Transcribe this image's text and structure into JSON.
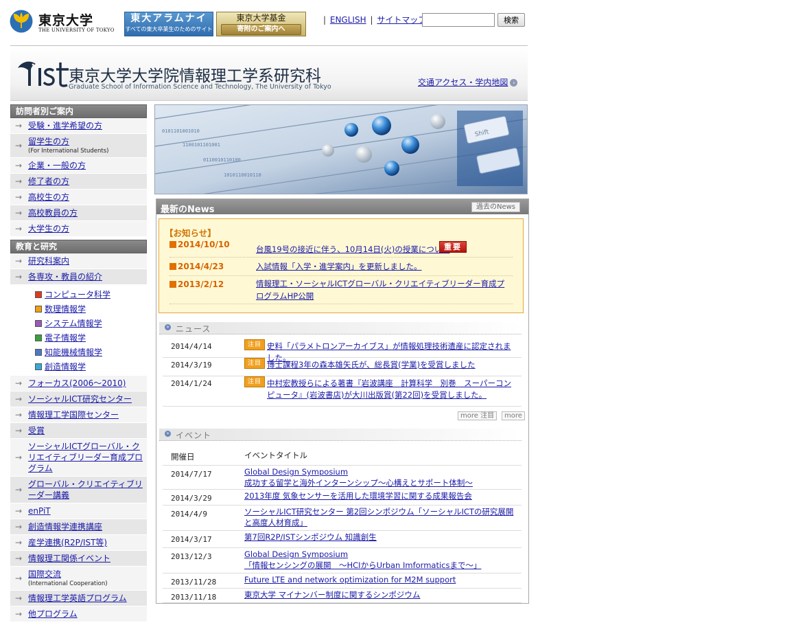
{
  "top": {
    "logo_jp": "東京大学",
    "logo_en": "THE UNIVERSITY OF TOKYO",
    "alumni_title": "東大アラムナイ",
    "alumni_sub": "すべての東大卒業生のためのサイト",
    "fund_title": "東京大学基金",
    "fund_sub": "寄附のご案内へ",
    "link_english": "ENGLISH",
    "link_sitemap": "サイトマップ",
    "search_value": "",
    "search_button": "検索"
  },
  "header": {
    "title": "東京大学大学院情報理工学系研究科",
    "subtitle": "Graduate School of Information Science and Technology, The University of Tokyo",
    "access_link": "交通アクセス・学内地図"
  },
  "sidebar": {
    "visitors_title": "訪問者別ご案内",
    "visitors": [
      {
        "label": "受験・進学希望の方",
        "sub": ""
      },
      {
        "label": "留学生の方",
        "sub": "(For International Students)"
      },
      {
        "label": "企業・一般の方",
        "sub": ""
      },
      {
        "label": "修了者の方",
        "sub": ""
      },
      {
        "label": "高校生の方",
        "sub": ""
      },
      {
        "label": "高校教員の方",
        "sub": ""
      },
      {
        "label": "大学生の方",
        "sub": ""
      }
    ],
    "edu_title": "教育と研究",
    "edu_top": [
      "研究科案内",
      "各専攻・教員の紹介"
    ],
    "departments": [
      {
        "label": "コンピュータ科学",
        "color": "#e03a1e"
      },
      {
        "label": "数理情報学",
        "color": "#f0a010"
      },
      {
        "label": "システム情報学",
        "color": "#9a58b8"
      },
      {
        "label": "電子情報学",
        "color": "#3aa03a"
      },
      {
        "label": "知能機械情報学",
        "color": "#4a78c8"
      },
      {
        "label": "創造情報学",
        "color": "#38a8d8"
      }
    ],
    "edu_rest": [
      {
        "label": "フォーカス(2006〜2010)",
        "sub": ""
      },
      {
        "label": "ソーシャルICT研究センター",
        "sub": ""
      },
      {
        "label": "情報理工学国際センター",
        "sub": ""
      },
      {
        "label": "受賞",
        "sub": ""
      },
      {
        "label": "ソーシャルICTグローバル・クリエイティブリーダー育成プログラム",
        "sub": ""
      },
      {
        "label": "グローバル・クリエイティブリーダー講義",
        "sub": ""
      },
      {
        "label": "enPiT",
        "sub": ""
      },
      {
        "label": "創造情報学連携講座",
        "sub": ""
      },
      {
        "label": "産学連携(R2P/IST等)",
        "sub": ""
      },
      {
        "label": "情報理工関係イベント",
        "sub": ""
      },
      {
        "label": "国際交流",
        "sub": "(International Cooperation)"
      },
      {
        "label": "情報理工学英語プログラム",
        "sub": ""
      },
      {
        "label": "他プログラム",
        "sub": ""
      }
    ]
  },
  "hero": {
    "key_label": "Shift"
  },
  "news": {
    "title": "最新のNews",
    "past_button": "過去のNews",
    "notice_title": "【お知らせ】",
    "important_badge": "重要",
    "notices": [
      {
        "date": "2014/10/10",
        "text": "台風19号の接近に伴う、10月14日(火)の授業について"
      },
      {
        "date": "2014/4/23",
        "text": "入試情報「入学・進学案内」を更新しました。"
      },
      {
        "date": "2013/2/12",
        "text": "情報理工・ソーシャルICTグローバル・クリエイティブリーダー育成プログラムHP公開"
      }
    ],
    "news_section": "ニュース",
    "items": [
      {
        "date": "2014/4/14",
        "tag": "注目",
        "text": "史料「パラメトロンアーカイブス」が情報処理技術遺産に認定されました。"
      },
      {
        "date": "2014/3/19",
        "tag": "注目",
        "text": "博士課程3年の森本雄矢氏が、総長賞(学業)を受賞しました"
      },
      {
        "date": "2014/1/24",
        "tag": "注目",
        "text": "中村宏教授らによる著書『岩波講座　計算科学　別巻　スーパーコンピュータ』(岩波書店)が大川出版賞(第22回)を受賞しました。"
      }
    ],
    "more_featured": "more 注目",
    "more": "more"
  },
  "events": {
    "section": "イベント",
    "col_date": "開催日",
    "col_title": "イベントタイトル",
    "items": [
      {
        "date": "2014/7/17",
        "text": "Global Design Symposium\n成功する留学と海外インターンシップ〜心構えとサポート体制〜"
      },
      {
        "date": "2014/3/29",
        "text": "2013年度 気象センサーを活用した環境学習に関する成果報告会"
      },
      {
        "date": "2014/4/9",
        "text": "ソーシャルICT研究センター 第2回シンポジウム「ソーシャルICTの研究展開と高度人材育成」"
      },
      {
        "date": "2014/3/17",
        "text": "第7回R2P/ISTシンポジウム 知識創生"
      },
      {
        "date": "2013/12/3",
        "text": "Global Design Symposium\n「情報センシングの展開　〜HCIからUrban Imformaticsまで〜」"
      },
      {
        "date": "2013/11/28",
        "text": "Future LTE and network optimization for M2M support"
      },
      {
        "date": "2013/11/18",
        "text": "東京大学 マイナンバー制度に関するシンポジウム"
      }
    ]
  }
}
